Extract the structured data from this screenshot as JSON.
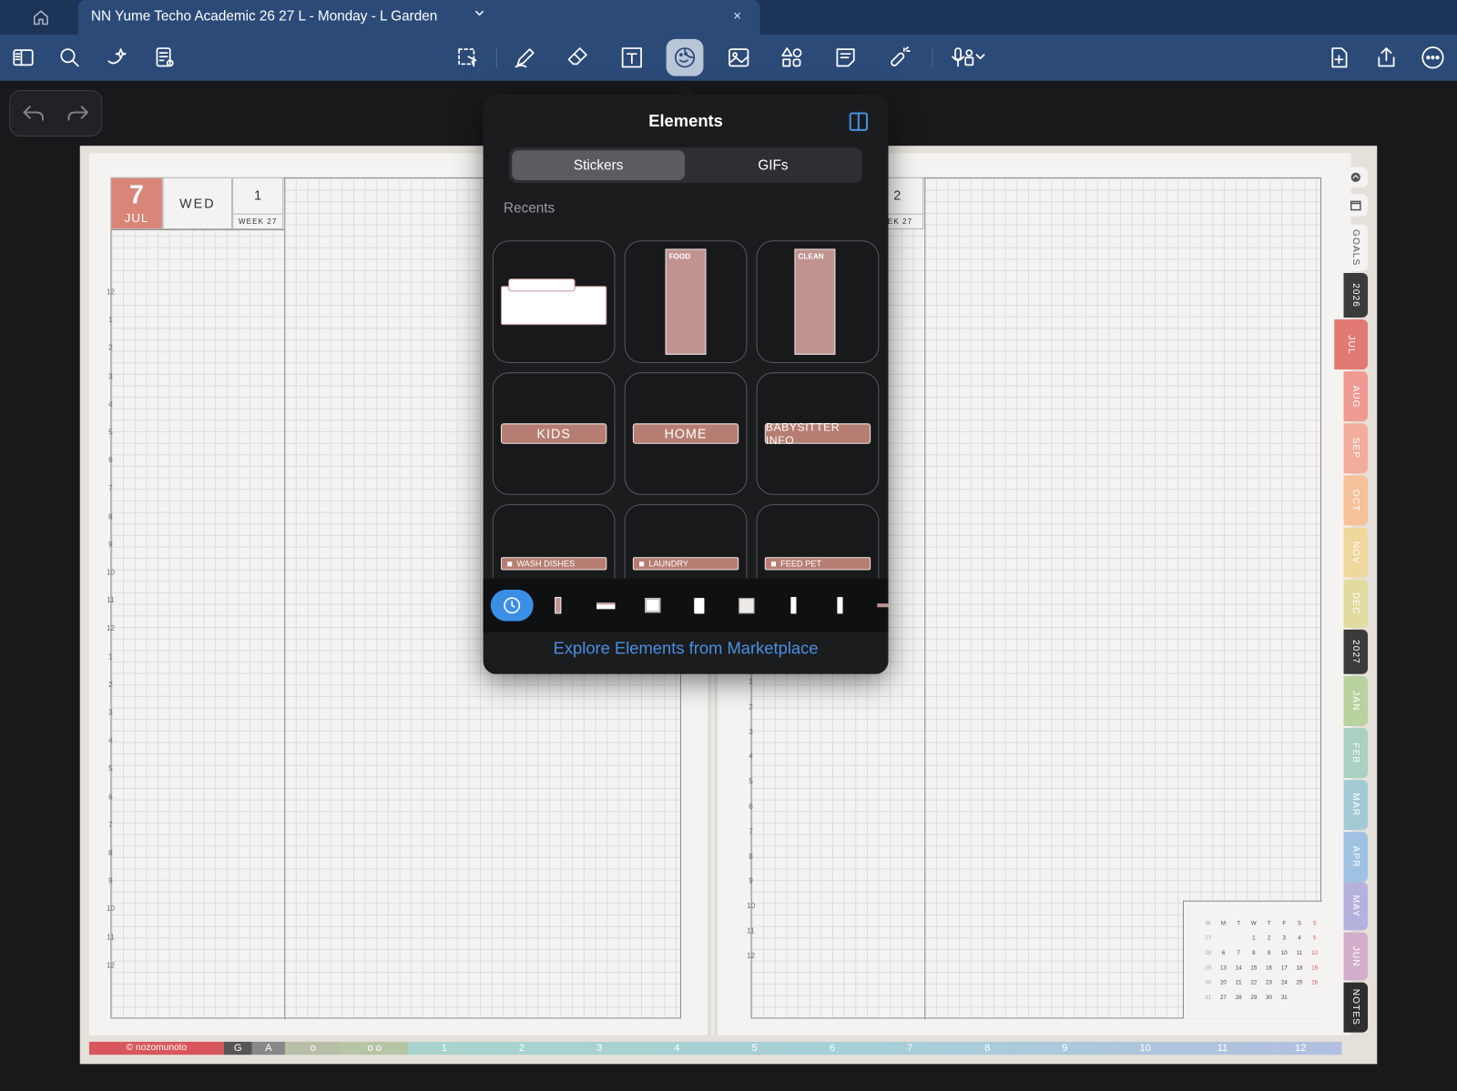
{
  "tab": {
    "title": "NN Yume Techo Academic 26 27 L - Monday - L Garden",
    "close": "×"
  },
  "toolbar": {
    "left": [
      "sidebar-icon",
      "search-icon",
      "ai-sparkle-icon",
      "document-tools-icon"
    ],
    "center": [
      "lasso-icon",
      "pen-icon",
      "eraser-icon",
      "text-box-icon",
      "elements-icon",
      "image-icon",
      "shapes-icon",
      "sticky-note-icon",
      "laser-pointer-icon",
      "mic-icon"
    ],
    "right": [
      "add-page-icon",
      "share-icon",
      "more-icon"
    ],
    "active": "elements-icon"
  },
  "planner": {
    "left_day": {
      "day": "7",
      "month": "JUL",
      "weekday": "WED",
      "num": "1",
      "week": "WEEK 27"
    },
    "right_day": {
      "num": "2",
      "week": "EEK 27"
    },
    "hours_top": [
      "12",
      "1",
      "2",
      "3",
      "4",
      "5",
      "6",
      "7",
      "8",
      "9",
      "10",
      "11",
      "12"
    ],
    "hours_bottom": [
      "1",
      "2",
      "3",
      "4",
      "5",
      "6",
      "7",
      "8",
      "9",
      "10",
      "11",
      "12"
    ],
    "side_tabs": [
      {
        "label": "GOALS",
        "color": "#f4f3f1",
        "text": "#555"
      },
      {
        "label": "2026",
        "color": "#3b3b3b",
        "text": "#fff"
      },
      {
        "label": "JUL",
        "color": "#e07a73",
        "text": "#fff"
      },
      {
        "label": "AUG",
        "color": "#ef9a93",
        "text": "#fff"
      },
      {
        "label": "SEP",
        "color": "#f4ad9c",
        "text": "#fff"
      },
      {
        "label": "OCT",
        "color": "#f7c19a",
        "text": "#fff"
      },
      {
        "label": "NOV",
        "color": "#f0d79c",
        "text": "#fff"
      },
      {
        "label": "DEC",
        "color": "#e2dba0",
        "text": "#fff"
      },
      {
        "label": "2027",
        "color": "#3b3b3b",
        "text": "#fff"
      },
      {
        "label": "JAN",
        "color": "#b9d29e",
        "text": "#fff"
      },
      {
        "label": "FEB",
        "color": "#a9d0c0",
        "text": "#fff"
      },
      {
        "label": "MAR",
        "color": "#a3cbd6",
        "text": "#fff"
      },
      {
        "label": "APR",
        "color": "#9fc2e3",
        "text": "#fff"
      },
      {
        "label": "MAY",
        "color": "#b4b2dc",
        "text": "#fff"
      },
      {
        "label": "JUN",
        "color": "#d3aecb",
        "text": "#fff"
      },
      {
        "label": "NOTES",
        "color": "#2e2e2e",
        "text": "#fff"
      }
    ],
    "footer": {
      "brand": "© nozomunoto",
      "g": "G",
      "a": "A",
      "o1": "o",
      "o2": "o o",
      "months": [
        "1",
        "2",
        "3",
        "4",
        "5",
        "6",
        "7",
        "8",
        "9",
        "10",
        "11",
        "12"
      ]
    },
    "mini_calendar": {
      "headers": [
        "W",
        "M",
        "T",
        "W",
        "T",
        "F",
        "S",
        "S"
      ],
      "rows": [
        [
          "27",
          "",
          "",
          "1",
          "2",
          "3",
          "4",
          "5"
        ],
        [
          "28",
          "6",
          "7",
          "8",
          "9",
          "10",
          "11",
          "12"
        ],
        [
          "29",
          "13",
          "14",
          "15",
          "16",
          "17",
          "18",
          "19"
        ],
        [
          "30",
          "20",
          "21",
          "22",
          "23",
          "24",
          "25",
          "26"
        ],
        [
          "31",
          "27",
          "28",
          "29",
          "30",
          "31",
          "",
          ""
        ]
      ]
    }
  },
  "elements_popup": {
    "title": "Elements",
    "segments": [
      "Stickers",
      "GIFs"
    ],
    "selected_segment": "Stickers",
    "section": "Recents",
    "stickers": {
      "food": "FOOD",
      "clean": "CLEAN",
      "kids": "KIDS",
      "home": "HOME",
      "babysitter": "BABYSITTER INFO",
      "wash": "WASH DISHES",
      "laundry": "LAUNDRY",
      "feed": "FEED PET"
    },
    "explore": "Explore Elements from Marketplace"
  }
}
